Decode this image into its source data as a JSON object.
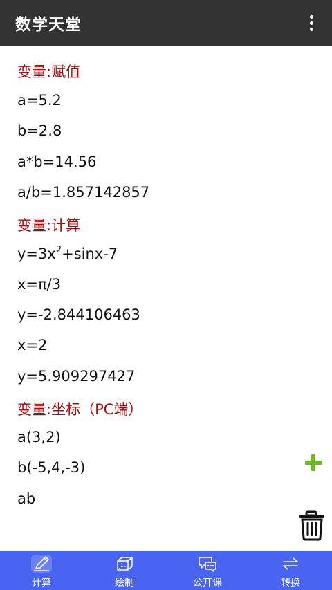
{
  "app": {
    "title": "数学天堂"
  },
  "content": {
    "lines": [
      {
        "text": "变量:赋值",
        "type": "heading"
      },
      {
        "text": "a=5.2",
        "type": "text"
      },
      {
        "text": "b=2.8",
        "type": "text"
      },
      {
        "text": "a*b=14.56",
        "type": "text"
      },
      {
        "text": "a/b=1.857142857",
        "type": "text"
      },
      {
        "text": "变量:计算",
        "type": "heading"
      },
      {
        "pre": "y=3x",
        "sup": "2",
        "post": "+sinx-7",
        "type": "formula"
      },
      {
        "text": "x=π/3",
        "type": "text"
      },
      {
        "text": "y=-2.844106463",
        "type": "text"
      },
      {
        "text": "x=2",
        "type": "text"
      },
      {
        "text": "y=5.909297427",
        "type": "text"
      },
      {
        "text": "变量:坐标（PC端）",
        "type": "heading"
      },
      {
        "text": "a(3,2)",
        "type": "text"
      },
      {
        "text": "b(-5,4,-3)",
        "type": "text"
      },
      {
        "text": "ab",
        "type": "text"
      }
    ]
  },
  "fab": {
    "add_icon": "plus-icon",
    "delete_icon": "trash-icon"
  },
  "nav": {
    "items": [
      {
        "label": "计算",
        "icon": "pencil-icon",
        "active": true
      },
      {
        "label": "绘制",
        "icon": "cube-icon",
        "active": false
      },
      {
        "label": "公开课",
        "icon": "chat-bubbles-icon",
        "active": false
      },
      {
        "label": "转换",
        "icon": "swap-arrows-icon",
        "active": false
      }
    ]
  },
  "colors": {
    "appbar": "#333333",
    "heading": "#a01010",
    "nav": "#4a64f2",
    "add": "#6cbb1c"
  }
}
